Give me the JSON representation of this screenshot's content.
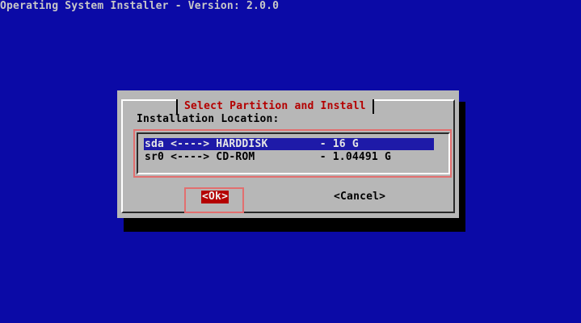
{
  "screen": {
    "title": "Operating System Installer - Version: 2.0.0"
  },
  "dialog": {
    "title": "Select Partition and Install",
    "label": "Installation Location:",
    "partitions": [
      {
        "text": "sda <----> HARDDISK        - 16 G",
        "selected": true
      },
      {
        "text": "sr0 <----> CD-ROM          - 1.04491 G",
        "selected": false
      }
    ],
    "buttons": {
      "ok": "<Ok>",
      "cancel": "<Cancel>"
    }
  },
  "colors": {
    "background": "#0b0aa6",
    "dialog": "#b7b7b7",
    "title": "#b40000",
    "selected_row": "#1e1aa8",
    "highlight_box": "#e26f6f"
  }
}
